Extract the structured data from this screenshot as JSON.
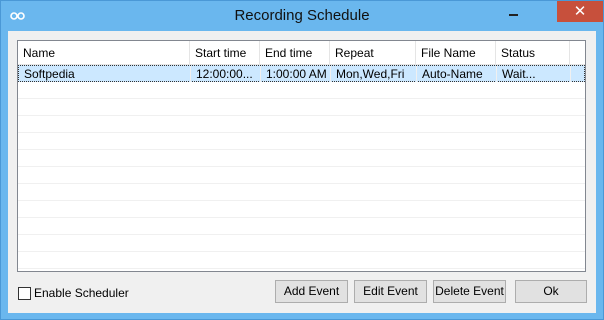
{
  "window": {
    "title": "Recording Schedule",
    "close_glyph": "✕"
  },
  "icons": {
    "app": "app-logo-icon",
    "minimize": "minimize-icon",
    "close": "close-icon",
    "checkbox": "checkbox-icon"
  },
  "colors": {
    "titlebar": "#6ab7ee",
    "close_button": "#c7503c",
    "selection": "#cce8ff",
    "button_face": "#e1e1e1"
  },
  "table": {
    "columns": [
      "Name",
      "Start time",
      "End time",
      "Repeat",
      "File Name",
      "Status"
    ],
    "rows": [
      [
        "Softpedia",
        "12:00:00...",
        "1:00:00 AM",
        "Mon,Wed,Fri",
        "Auto-Name",
        "Wait..."
      ]
    ]
  },
  "options": {
    "enable_scheduler_label": "Enable Scheduler",
    "enable_scheduler_checked": false
  },
  "buttons": {
    "add_event": "Add Event",
    "edit_event": "Edit Event",
    "delete_event": "Delete Event",
    "ok": "Ok"
  }
}
